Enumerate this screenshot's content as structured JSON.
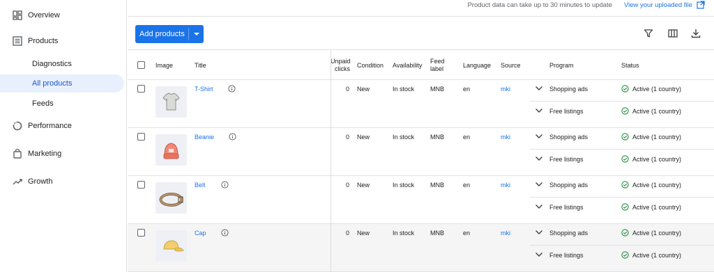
{
  "sidebar": {
    "items": [
      {
        "label": "Overview",
        "icon": "dashboard-icon"
      },
      {
        "label": "Products",
        "icon": "list-icon"
      },
      {
        "label": "Diagnostics"
      },
      {
        "label": "All products",
        "active": true
      },
      {
        "label": "Feeds"
      },
      {
        "label": "Performance",
        "icon": "performance-icon"
      },
      {
        "label": "Marketing",
        "icon": "marketing-icon"
      },
      {
        "label": "Growth",
        "icon": "growth-icon"
      }
    ]
  },
  "topbar": {
    "note": "Product data can take up to 30 minutes to update",
    "link": "View your uploaded file"
  },
  "toolbar": {
    "add_label": "Add products",
    "accent": "#1a73e8"
  },
  "table": {
    "headers": {
      "image": "Image",
      "title": "Title",
      "unpaid": "Unpaid clicks",
      "condition": "Condition",
      "availability": "Availability",
      "feed": "Feed label",
      "language": "Language",
      "source": "Source",
      "program": "Program",
      "status": "Status"
    },
    "rows": [
      {
        "title": "T-Shirt",
        "clicks": "0",
        "condition": "New",
        "availability": "In stock",
        "feed": "MNB",
        "language": "en",
        "source": "mki",
        "programs": [
          {
            "name": "Shopping ads",
            "status": "Active (1 country)"
          },
          {
            "name": "Free listings",
            "status": "Active (1 country)"
          }
        ]
      },
      {
        "title": "Beanie",
        "clicks": "0",
        "condition": "New",
        "availability": "In stock",
        "feed": "MNB",
        "language": "en",
        "source": "mki",
        "programs": [
          {
            "name": "Shopping ads",
            "status": "Active (1 country)"
          },
          {
            "name": "Free listings",
            "status": "Active (1 country)"
          }
        ]
      },
      {
        "title": "Belt",
        "clicks": "0",
        "condition": "New",
        "availability": "In stock",
        "feed": "MNB",
        "language": "en",
        "source": "mki",
        "programs": [
          {
            "name": "Shopping ads",
            "status": "Active (1 country)"
          },
          {
            "name": "Free listings",
            "status": "Active (1 country)"
          }
        ]
      },
      {
        "title": "Cap",
        "clicks": "0",
        "condition": "New",
        "availability": "In stock",
        "feed": "MNB",
        "language": "en",
        "source": "mki",
        "programs": [
          {
            "name": "Shopping ads",
            "status": "Active (1 country)"
          },
          {
            "name": "Free listings",
            "status": "Active (1 country)"
          }
        ]
      }
    ],
    "status_color": "#1e8e3e"
  }
}
